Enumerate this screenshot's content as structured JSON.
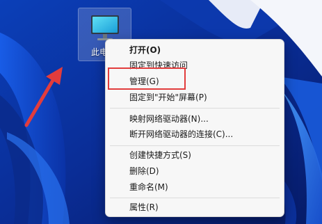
{
  "desktop": {
    "icon_name": "monitor-icon",
    "icon_label": "此电"
  },
  "context_menu": {
    "items": [
      {
        "label": "打开(O)",
        "bold": true
      },
      {
        "label": "固定到快速访问"
      },
      {
        "label": "管理(G)"
      },
      {
        "label": "固定到\"开始\"屏幕(P)"
      },
      {
        "label": "映射网络驱动器(N)..."
      },
      {
        "label": "断开网络驱动器的连接(C)..."
      },
      {
        "label": "创建快捷方式(S)"
      },
      {
        "label": "删除(D)"
      },
      {
        "label": "重命名(M)"
      },
      {
        "label": "属性(R)"
      }
    ]
  },
  "annotation": {
    "arrow_color": "#e23c3c",
    "highlight_color": "#e23c3c",
    "highlighted_item": "管理(G)"
  }
}
